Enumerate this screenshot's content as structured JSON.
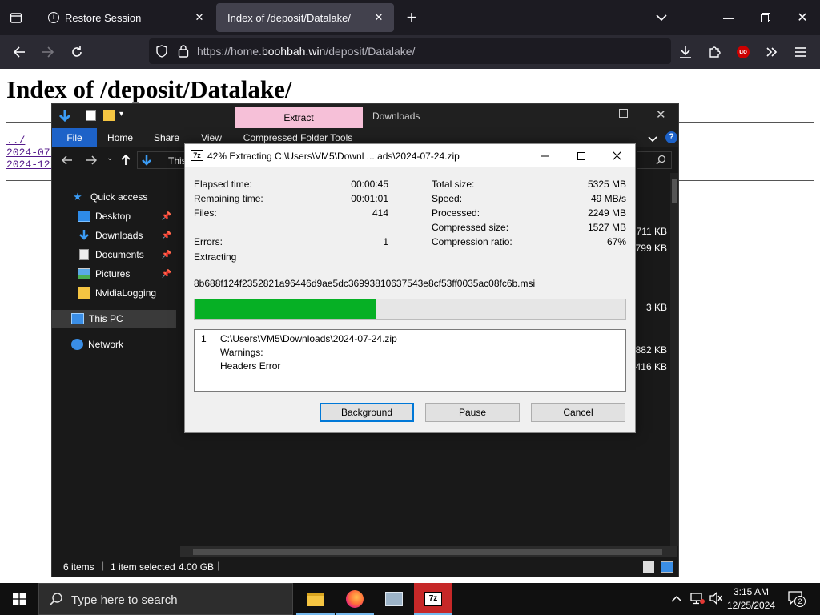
{
  "browser": {
    "tabs": [
      {
        "label": "Restore Session",
        "active": false
      },
      {
        "label": "Index of /deposit/Datalake/",
        "active": true
      }
    ],
    "url_prefix": "https://home.",
    "url_domain": "boohbah.win",
    "url_path": "/deposit/Datalake/",
    "extension_badge": "uo"
  },
  "page": {
    "title": "Index of /deposit/Datalake/",
    "links": [
      "../",
      "2024-07-",
      "2024-12-"
    ]
  },
  "explorer": {
    "context_tab": "Extract",
    "title_folder": "Downloads",
    "ribbon": [
      "File",
      "Home",
      "Share",
      "View",
      "Compressed Folder Tools"
    ],
    "address_fragment": "This",
    "nav_items": [
      {
        "label": "Quick access",
        "icon": "star-icon"
      },
      {
        "label": "Desktop",
        "icon": "desktop-icon",
        "pinned": true
      },
      {
        "label": "Downloads",
        "icon": "download-icon",
        "pinned": true
      },
      {
        "label": "Documents",
        "icon": "document-icon",
        "pinned": true
      },
      {
        "label": "Pictures",
        "icon": "pictures-icon",
        "pinned": true
      },
      {
        "label": "NvidiaLogging",
        "icon": "folder-icon"
      },
      {
        "label": "This PC",
        "icon": "pc-icon",
        "selected": true
      },
      {
        "label": "Network",
        "icon": "network-icon"
      }
    ],
    "sizes": [
      "711 KB",
      "799 KB",
      "3 KB",
      "882 KB",
      "416 KB"
    ],
    "status": {
      "items": "6 items",
      "selected": "1 item selected",
      "size": "4.00 GB"
    }
  },
  "zip_dialog": {
    "title": "42% Extracting C:\\Users\\VM5\\Downl ... ads\\2024-07-24.zip",
    "icon_label": "7z",
    "left_stats": [
      {
        "label": "Elapsed time:",
        "value": "00:00:45"
      },
      {
        "label": "Remaining time:",
        "value": "00:01:01"
      },
      {
        "label": "Files:",
        "value": "414"
      },
      {
        "label": "",
        "value": ""
      },
      {
        "label": "Errors:",
        "value": "1"
      }
    ],
    "right_stats": [
      {
        "label": "Total size:",
        "value": "5325 MB"
      },
      {
        "label": "Speed:",
        "value": "49 MB/s"
      },
      {
        "label": "Processed:",
        "value": "2249 MB"
      },
      {
        "label": "Compressed size:",
        "value": "1527 MB"
      },
      {
        "label": "Compression ratio:",
        "value": "67%"
      }
    ],
    "status_label": "Extracting",
    "current_file": "8b688f124f2352821a96446d9ae5dc36993810637543e8cf53ff0035ac08fc6b.msi",
    "progress": 0.42,
    "messages": {
      "index": "1",
      "path": "C:\\Users\\VM5\\Downloads\\2024-07-24.zip",
      "line2": "Warnings:",
      "line3": "Headers Error"
    },
    "buttons": {
      "background": "Background",
      "pause": "Pause",
      "cancel": "Cancel"
    }
  },
  "taskbar": {
    "search_placeholder": "Type here to search",
    "time": "3:15 AM",
    "date": "12/25/2024",
    "notification_count": "2"
  },
  "colors": {
    "progress": "#06b025",
    "extract_tab": "#f6c0d8",
    "file_tab": "#1d62c8"
  }
}
